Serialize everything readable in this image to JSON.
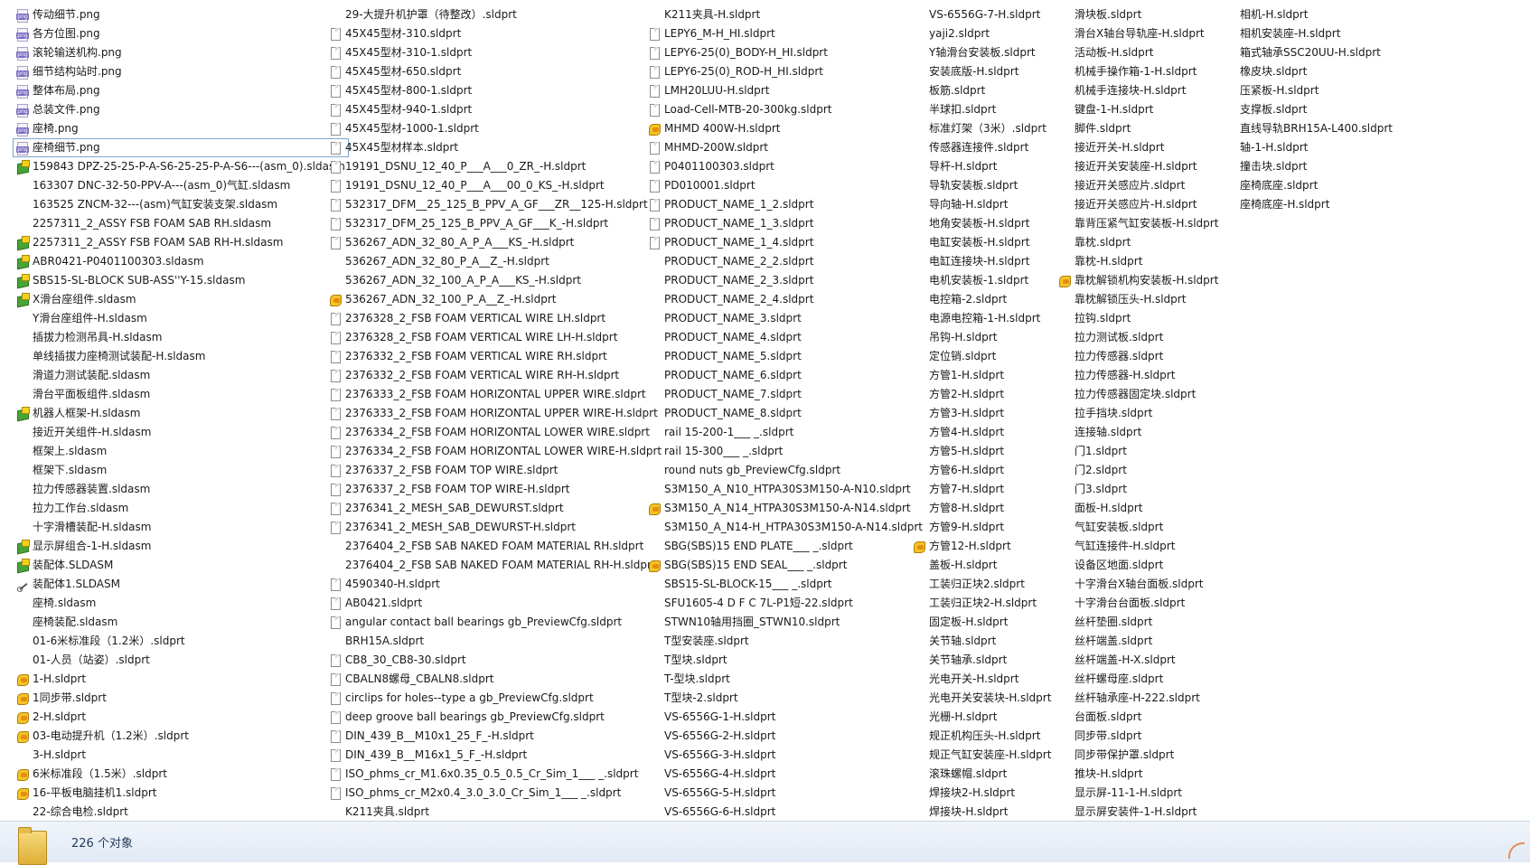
{
  "columns": [
    [
      {
        "name": "传动细节.png",
        "icon": "png"
      },
      {
        "name": "各方位图.png",
        "icon": "png"
      },
      {
        "name": "滚轮输送机构.png",
        "icon": "png"
      },
      {
        "name": "细节结构站时.png",
        "icon": "png"
      },
      {
        "name": "整体布局.png",
        "icon": "png"
      },
      {
        "name": "总装文件.png",
        "icon": "png"
      },
      {
        "name": "座椅.png",
        "icon": "png"
      },
      {
        "name": "座椅细节.png",
        "icon": "png",
        "selected": true
      },
      {
        "name": "159843 DPZ-25-25-P-A-S6-25-25-P-A-S6---(asm_0).sldasm",
        "icon": "asm"
      },
      {
        "name": "163307 DNC-32-50-PPV-A---(asm_0)气缸.sldasm",
        "icon": "none"
      },
      {
        "name": "163525 ZNCM-32---(asm)气缸安装支架.sldasm",
        "icon": "none"
      },
      {
        "name": "2257311_2_ASSY FSB FOAM SAB RH.sldasm",
        "icon": "none"
      },
      {
        "name": "2257311_2_ASSY FSB FOAM SAB RH-H.sldasm",
        "icon": "asm"
      },
      {
        "name": "ABR0421-P0401100303.sldasm",
        "icon": "asm"
      },
      {
        "name": "SBS15-SL-BLOCK SUB-ASS''Y-15.sldasm",
        "icon": "asm"
      },
      {
        "name": "X滑台座组件.sldasm",
        "icon": "asm"
      },
      {
        "name": "Y滑台座组件-H.sldasm",
        "icon": "none"
      },
      {
        "name": "插拔力检测吊具-H.sldasm",
        "icon": "none"
      },
      {
        "name": "单线插拔力座椅测试装配-H.sldasm",
        "icon": "none"
      },
      {
        "name": "滑道力测试装配.sldasm",
        "icon": "none"
      },
      {
        "name": "滑台平面板组件.sldasm",
        "icon": "none"
      },
      {
        "name": "机器人框架-H.sldasm",
        "icon": "asm"
      },
      {
        "name": "接近开关组件-H.sldasm",
        "icon": "none"
      },
      {
        "name": "框架上.sldasm",
        "icon": "none"
      },
      {
        "name": "框架下.sldasm",
        "icon": "none"
      },
      {
        "name": "拉力传感器装置.sldasm",
        "icon": "none"
      },
      {
        "name": "拉力工作台.sldasm",
        "icon": "none"
      },
      {
        "name": "十字滑槽装配-H.sldasm",
        "icon": "none"
      },
      {
        "name": "显示屏组合-1-H.sldasm",
        "icon": "asm"
      },
      {
        "name": "装配体.SLDASM",
        "icon": "asm"
      },
      {
        "name": "装配体1.SLDASM",
        "icon": "link"
      },
      {
        "name": "座椅.sldasm",
        "icon": "none"
      },
      {
        "name": "座椅装配.sldasm",
        "icon": "none"
      },
      {
        "name": "01-6米标准段（1.2米）.sldprt",
        "icon": "none"
      },
      {
        "name": "01-人员（站姿）.sldprt",
        "icon": "none"
      },
      {
        "name": "1-H.sldprt",
        "icon": "part"
      },
      {
        "name": "1同步带.sldprt",
        "icon": "part"
      },
      {
        "name": "2-H.sldprt",
        "icon": "part"
      },
      {
        "name": "03-电动提升机（1.2米）.sldprt",
        "icon": "part"
      },
      {
        "name": "3-H.sldprt",
        "icon": "none"
      },
      {
        "name": "6米标准段（1.5米）.sldprt",
        "icon": "part"
      },
      {
        "name": "16-平板电脑挂机1.sldprt",
        "icon": "part"
      },
      {
        "name": "22-综合电检.sldprt",
        "icon": "none"
      }
    ],
    [
      {
        "name": "29-大提升机护罩（待整改）.sldprt",
        "icon": "none"
      },
      {
        "name": "45X45型材-310.sldprt",
        "icon": "doc"
      },
      {
        "name": "45X45型材-310-1.sldprt",
        "icon": "doc"
      },
      {
        "name": "45X45型材-650.sldprt",
        "icon": "doc"
      },
      {
        "name": "45X45型材-800-1.sldprt",
        "icon": "doc"
      },
      {
        "name": "45X45型材-940-1.sldprt",
        "icon": "doc"
      },
      {
        "name": "45X45型材-1000-1.sldprt",
        "icon": "doc"
      },
      {
        "name": "45X45型材样本.sldprt",
        "icon": "doc"
      },
      {
        "name": "19191_DSNU_12_40_P___A___0_ZR_-H.sldprt",
        "icon": "doc"
      },
      {
        "name": "19191_DSNU_12_40_P___A___00_0_KS_-H.sldprt",
        "icon": "doc"
      },
      {
        "name": "532317_DFM__25_125_B_PPV_A_GF___ZR__125-H.sldprt",
        "icon": "doc"
      },
      {
        "name": "532317_DFM_25_125_B_PPV_A_GF___K_-H.sldprt",
        "icon": "doc"
      },
      {
        "name": "536267_ADN_32_80_A_P_A___KS_-H.sldprt",
        "icon": "doc"
      },
      {
        "name": "536267_ADN_32_80_P_A__Z_-H.sldprt",
        "icon": "none"
      },
      {
        "name": "536267_ADN_32_100_A_P_A___KS_-H.sldprt",
        "icon": "none"
      },
      {
        "name": "536267_ADN_32_100_P_A__Z_-H.sldprt",
        "icon": "part"
      },
      {
        "name": "2376328_2_FSB FOAM VERTICAL WIRE LH.sldprt",
        "icon": "doc"
      },
      {
        "name": "2376328_2_FSB FOAM VERTICAL WIRE LH-H.sldprt",
        "icon": "doc"
      },
      {
        "name": "2376332_2_FSB FOAM VERTICAL WIRE RH.sldprt",
        "icon": "doc"
      },
      {
        "name": "2376332_2_FSB FOAM VERTICAL WIRE RH-H.sldprt",
        "icon": "doc"
      },
      {
        "name": "2376333_2_FSB FOAM HORIZONTAL UPPER WIRE.sldprt",
        "icon": "doc"
      },
      {
        "name": "2376333_2_FSB FOAM HORIZONTAL UPPER WIRE-H.sldprt",
        "icon": "doc"
      },
      {
        "name": "2376334_2_FSB FOAM HORIZONTAL LOWER WIRE.sldprt",
        "icon": "doc"
      },
      {
        "name": "2376334_2_FSB FOAM HORIZONTAL LOWER WIRE-H.sldprt",
        "icon": "doc"
      },
      {
        "name": "2376337_2_FSB FOAM TOP WIRE.sldprt",
        "icon": "doc"
      },
      {
        "name": "2376337_2_FSB FOAM TOP WIRE-H.sldprt",
        "icon": "doc"
      },
      {
        "name": "2376341_2_MESH_SAB_DEWURST.sldprt",
        "icon": "doc"
      },
      {
        "name": "2376341_2_MESH_SAB_DEWURST-H.sldprt",
        "icon": "doc"
      },
      {
        "name": "2376404_2_FSB SAB NAKED FOAM MATERIAL RH.sldprt",
        "icon": "none"
      },
      {
        "name": "2376404_2_FSB SAB NAKED FOAM MATERIAL RH-H.sldprt",
        "icon": "none"
      },
      {
        "name": "4590340-H.sldprt",
        "icon": "doc"
      },
      {
        "name": "AB0421.sldprt",
        "icon": "doc"
      },
      {
        "name": "angular contact ball bearings gb_PreviewCfg.sldprt",
        "icon": "doc"
      },
      {
        "name": "BRH15A.sldprt",
        "icon": "none"
      },
      {
        "name": "CB8_30_CB8-30.sldprt",
        "icon": "doc"
      },
      {
        "name": "CBALN8螺母_CBALN8.sldprt",
        "icon": "doc"
      },
      {
        "name": "circlips for holes--type a gb_PreviewCfg.sldprt",
        "icon": "doc"
      },
      {
        "name": "deep groove ball bearings gb_PreviewCfg.sldprt",
        "icon": "doc"
      },
      {
        "name": "DIN_439_B__M10x1_25_F_-H.sldprt",
        "icon": "doc"
      },
      {
        "name": "DIN_439_B__M16x1_5_F_-H.sldprt",
        "icon": "doc"
      },
      {
        "name": "ISO_phms_cr_M1.6x0.35_0.5_0.5_Cr_Sim_1___ _.sldprt",
        "icon": "doc"
      },
      {
        "name": "ISO_phms_cr_M2x0.4_3.0_3.0_Cr_Sim_1___ _.sldprt",
        "icon": "doc"
      },
      {
        "name": "K211夹具.sldprt",
        "icon": "none"
      }
    ],
    [
      {
        "name": "K211夹具-H.sldprt",
        "icon": "none"
      },
      {
        "name": "LEPY6_M-H_HI.sldprt",
        "icon": "doc"
      },
      {
        "name": "LEPY6-25(0)_BODY-H_HI.sldprt",
        "icon": "doc"
      },
      {
        "name": "LEPY6-25(0)_ROD-H_HI.sldprt",
        "icon": "doc"
      },
      {
        "name": "LMH20LUU-H.sldprt",
        "icon": "doc"
      },
      {
        "name": "Load-Cell-MTB-20-300kg.sldprt",
        "icon": "doc"
      },
      {
        "name": "MHMD 400W-H.sldprt",
        "icon": "part"
      },
      {
        "name": "MHMD-200W.sldprt",
        "icon": "doc"
      },
      {
        "name": "P0401100303.sldprt",
        "icon": "doc"
      },
      {
        "name": "PD010001.sldprt",
        "icon": "doc"
      },
      {
        "name": "PRODUCT_NAME_1_2.sldprt",
        "icon": "doc"
      },
      {
        "name": "PRODUCT_NAME_1_3.sldprt",
        "icon": "doc"
      },
      {
        "name": "PRODUCT_NAME_1_4.sldprt",
        "icon": "doc"
      },
      {
        "name": "PRODUCT_NAME_2_2.sldprt",
        "icon": "none"
      },
      {
        "name": "PRODUCT_NAME_2_3.sldprt",
        "icon": "none"
      },
      {
        "name": "PRODUCT_NAME_2_4.sldprt",
        "icon": "none"
      },
      {
        "name": "PRODUCT_NAME_3.sldprt",
        "icon": "none"
      },
      {
        "name": "PRODUCT_NAME_4.sldprt",
        "icon": "none"
      },
      {
        "name": "PRODUCT_NAME_5.sldprt",
        "icon": "none"
      },
      {
        "name": "PRODUCT_NAME_6.sldprt",
        "icon": "none"
      },
      {
        "name": "PRODUCT_NAME_7.sldprt",
        "icon": "none"
      },
      {
        "name": "PRODUCT_NAME_8.sldprt",
        "icon": "none"
      },
      {
        "name": "rail 15-200-1___ _.sldprt",
        "icon": "none"
      },
      {
        "name": "rail 15-300___ _.sldprt",
        "icon": "none"
      },
      {
        "name": "round nuts gb_PreviewCfg.sldprt",
        "icon": "none"
      },
      {
        "name": "S3M150_A_N10_HTPA30S3M150-A-N10.sldprt",
        "icon": "none"
      },
      {
        "name": "S3M150_A_N14_HTPA30S3M150-A-N14.sldprt",
        "icon": "part"
      },
      {
        "name": "S3M150_A_N14-H_HTPA30S3M150-A-N14.sldprt",
        "icon": "none"
      },
      {
        "name": "SBG(SBS)15 END PLATE___ _.sldprt",
        "icon": "none"
      },
      {
        "name": "SBG(SBS)15 END SEAL___ _.sldprt",
        "icon": "part"
      },
      {
        "name": "SBS15-SL-BLOCK-15___ _.sldprt",
        "icon": "none"
      },
      {
        "name": "SFU1605-4 D F C 7L-P1短-22.sldprt",
        "icon": "none"
      },
      {
        "name": "STWN10轴用挡圈_STWN10.sldprt",
        "icon": "none"
      },
      {
        "name": "T型安装座.sldprt",
        "icon": "none"
      },
      {
        "name": "T型块.sldprt",
        "icon": "none"
      },
      {
        "name": "T-型块.sldprt",
        "icon": "none"
      },
      {
        "name": "T型块-2.sldprt",
        "icon": "none"
      },
      {
        "name": "VS-6556G-1-H.sldprt",
        "icon": "none"
      },
      {
        "name": "VS-6556G-2-H.sldprt",
        "icon": "none"
      },
      {
        "name": "VS-6556G-3-H.sldprt",
        "icon": "none"
      },
      {
        "name": "VS-6556G-4-H.sldprt",
        "icon": "none"
      },
      {
        "name": "VS-6556G-5-H.sldprt",
        "icon": "none"
      },
      {
        "name": "VS-6556G-6-H.sldprt",
        "icon": "none"
      }
    ],
    [
      {
        "name": "VS-6556G-7-H.sldprt",
        "icon": "none"
      },
      {
        "name": "yaji2.sldprt",
        "icon": "none"
      },
      {
        "name": "Y轴滑台安装板.sldprt",
        "icon": "none"
      },
      {
        "name": "安装底版-H.sldprt",
        "icon": "none"
      },
      {
        "name": "板筋.sldprt",
        "icon": "none"
      },
      {
        "name": "半球扣.sldprt",
        "icon": "none"
      },
      {
        "name": "标准灯架（3米）.sldprt",
        "icon": "none"
      },
      {
        "name": "传感器连接件.sldprt",
        "icon": "none"
      },
      {
        "name": "导杆-H.sldprt",
        "icon": "none"
      },
      {
        "name": "导轨安装板.sldprt",
        "icon": "none"
      },
      {
        "name": "导向轴-H.sldprt",
        "icon": "none"
      },
      {
        "name": "地角安装板-H.sldprt",
        "icon": "none"
      },
      {
        "name": "电缸安装板-H.sldprt",
        "icon": "none"
      },
      {
        "name": "电缸连接块-H.sldprt",
        "icon": "none"
      },
      {
        "name": "电机安装板-1.sldprt",
        "icon": "none"
      },
      {
        "name": "电控箱-2.sldprt",
        "icon": "none"
      },
      {
        "name": "电源电控箱-1-H.sldprt",
        "icon": "none"
      },
      {
        "name": "吊钩-H.sldprt",
        "icon": "none"
      },
      {
        "name": "定位销.sldprt",
        "icon": "none"
      },
      {
        "name": "方管1-H.sldprt",
        "icon": "none"
      },
      {
        "name": "方管2-H.sldprt",
        "icon": "none"
      },
      {
        "name": "方管3-H.sldprt",
        "icon": "none"
      },
      {
        "name": "方管4-H.sldprt",
        "icon": "none"
      },
      {
        "name": "方管5-H.sldprt",
        "icon": "none"
      },
      {
        "name": "方管6-H.sldprt",
        "icon": "none"
      },
      {
        "name": "方管7-H.sldprt",
        "icon": "none"
      },
      {
        "name": "方管8-H.sldprt",
        "icon": "none"
      },
      {
        "name": "方管9-H.sldprt",
        "icon": "none"
      },
      {
        "name": "方管12-H.sldprt",
        "icon": "part"
      },
      {
        "name": "盖板-H.sldprt",
        "icon": "none"
      },
      {
        "name": "工装归正块2.sldprt",
        "icon": "none"
      },
      {
        "name": "工装归正块2-H.sldprt",
        "icon": "none"
      },
      {
        "name": "固定板-H.sldprt",
        "icon": "none"
      },
      {
        "name": "关节轴.sldprt",
        "icon": "none"
      },
      {
        "name": "关节轴承.sldprt",
        "icon": "none"
      },
      {
        "name": "光电开关-H.sldprt",
        "icon": "none"
      },
      {
        "name": "光电开关安装块-H.sldprt",
        "icon": "none"
      },
      {
        "name": "光栅-H.sldprt",
        "icon": "none"
      },
      {
        "name": "规正机构压头-H.sldprt",
        "icon": "none"
      },
      {
        "name": "规正气缸安装座-H.sldprt",
        "icon": "none"
      },
      {
        "name": "滚珠螺帽.sldprt",
        "icon": "none"
      },
      {
        "name": "焊接块2-H.sldprt",
        "icon": "none"
      },
      {
        "name": "焊接块-H.sldprt",
        "icon": "none"
      }
    ],
    [
      {
        "name": "滑块板.sldprt",
        "icon": "none"
      },
      {
        "name": "滑台X轴台导轨座-H.sldprt",
        "icon": "none"
      },
      {
        "name": "活动板-H.sldprt",
        "icon": "none"
      },
      {
        "name": "机械手操作箱-1-H.sldprt",
        "icon": "none"
      },
      {
        "name": "机械手连接块-H.sldprt",
        "icon": "none"
      },
      {
        "name": "键盘-1-H.sldprt",
        "icon": "none"
      },
      {
        "name": "脚件.sldprt",
        "icon": "none"
      },
      {
        "name": "接近开关-H.sldprt",
        "icon": "none"
      },
      {
        "name": "接近开关安装座-H.sldprt",
        "icon": "none"
      },
      {
        "name": "接近开关感应片.sldprt",
        "icon": "none"
      },
      {
        "name": "接近开关感应片-H.sldprt",
        "icon": "none"
      },
      {
        "name": "靠背压紧气缸安装板-H.sldprt",
        "icon": "none"
      },
      {
        "name": "靠枕.sldprt",
        "icon": "none"
      },
      {
        "name": "靠枕-H.sldprt",
        "icon": "none"
      },
      {
        "name": "靠枕解锁机构安装板-H.sldprt",
        "icon": "part"
      },
      {
        "name": "靠枕解锁压头-H.sldprt",
        "icon": "none"
      },
      {
        "name": "拉钩.sldprt",
        "icon": "none"
      },
      {
        "name": "拉力测试板.sldprt",
        "icon": "none"
      },
      {
        "name": "拉力传感器.sldprt",
        "icon": "none"
      },
      {
        "name": "拉力传感器-H.sldprt",
        "icon": "none"
      },
      {
        "name": "拉力传感器固定块.sldprt",
        "icon": "none"
      },
      {
        "name": "拉手挡块.sldprt",
        "icon": "none"
      },
      {
        "name": "连接轴.sldprt",
        "icon": "none"
      },
      {
        "name": "门1.sldprt",
        "icon": "none"
      },
      {
        "name": "门2.sldprt",
        "icon": "none"
      },
      {
        "name": "门3.sldprt",
        "icon": "none"
      },
      {
        "name": "面板-H.sldprt",
        "icon": "none"
      },
      {
        "name": "气缸安装板.sldprt",
        "icon": "none"
      },
      {
        "name": "气缸连接件-H.sldprt",
        "icon": "none"
      },
      {
        "name": "设备区地面.sldprt",
        "icon": "none"
      },
      {
        "name": "十字滑台X轴台面板.sldprt",
        "icon": "none"
      },
      {
        "name": "十字滑台台面板.sldprt",
        "icon": "none"
      },
      {
        "name": "丝杆垫圈.sldprt",
        "icon": "none"
      },
      {
        "name": "丝杆端盖.sldprt",
        "icon": "none"
      },
      {
        "name": "丝杆端盖-H-X.sldprt",
        "icon": "none"
      },
      {
        "name": "丝杆螺母座.sldprt",
        "icon": "none"
      },
      {
        "name": "丝杆轴承座-H-222.sldprt",
        "icon": "none"
      },
      {
        "name": "台面板.sldprt",
        "icon": "none"
      },
      {
        "name": "同步带.sldprt",
        "icon": "none"
      },
      {
        "name": "同步带保护罩.sldprt",
        "icon": "none"
      },
      {
        "name": "推块-H.sldprt",
        "icon": "none"
      },
      {
        "name": "显示屏-11-1-H.sldprt",
        "icon": "none"
      },
      {
        "name": "显示屏安装件-1-H.sldprt",
        "icon": "none"
      }
    ],
    [
      {
        "name": "相机-H.sldprt",
        "icon": "none"
      },
      {
        "name": "相机安装座-H.sldprt",
        "icon": "none"
      },
      {
        "name": "箱式轴承SSC20UU-H.sldprt",
        "icon": "none"
      },
      {
        "name": "橡皮块.sldprt",
        "icon": "none"
      },
      {
        "name": "压紧板-H.sldprt",
        "icon": "none"
      },
      {
        "name": "支撑板.sldprt",
        "icon": "none"
      },
      {
        "name": "直线导轨BRH15A-L400.sldprt",
        "icon": "none"
      },
      {
        "name": "轴-1-H.sldprt",
        "icon": "none"
      },
      {
        "name": "撞击块.sldprt",
        "icon": "none"
      },
      {
        "name": "座椅底座.sldprt",
        "icon": "none"
      },
      {
        "name": "座椅底座-H.sldprt",
        "icon": "none"
      }
    ]
  ],
  "status": {
    "count_text": "226 个对象"
  }
}
